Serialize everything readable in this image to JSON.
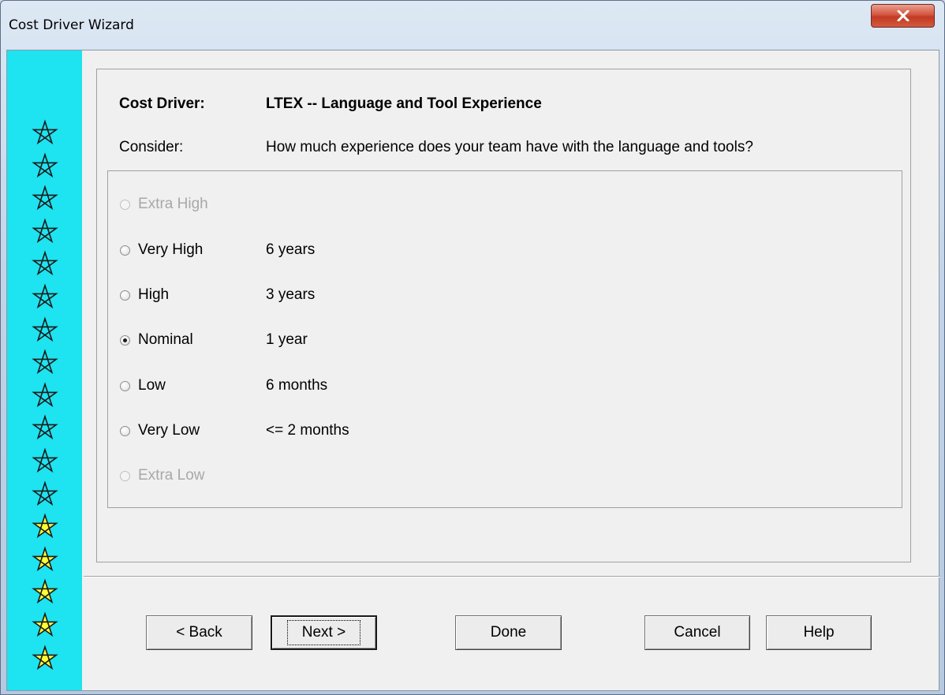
{
  "window": {
    "title": "Cost Driver Wizard",
    "close_icon": "close-icon",
    "accent_close": "#c8432c"
  },
  "sidebar": {
    "strip_color": "#1ee3f0",
    "stars": [
      {
        "icon": "star-outline-icon",
        "filled": false
      },
      {
        "icon": "star-outline-icon",
        "filled": false
      },
      {
        "icon": "star-outline-icon",
        "filled": false
      },
      {
        "icon": "star-outline-icon",
        "filled": false
      },
      {
        "icon": "star-outline-icon",
        "filled": false
      },
      {
        "icon": "star-outline-icon",
        "filled": false
      },
      {
        "icon": "star-outline-icon",
        "filled": false
      },
      {
        "icon": "star-outline-icon",
        "filled": false
      },
      {
        "icon": "star-outline-icon",
        "filled": false
      },
      {
        "icon": "star-outline-icon",
        "filled": false
      },
      {
        "icon": "star-outline-icon",
        "filled": false
      },
      {
        "icon": "star-outline-icon",
        "filled": false
      },
      {
        "icon": "star-filled-icon",
        "filled": true
      },
      {
        "icon": "star-filled-icon",
        "filled": true
      },
      {
        "icon": "star-filled-icon",
        "filled": true
      },
      {
        "icon": "star-filled-icon",
        "filled": true
      },
      {
        "icon": "star-filled-icon",
        "filled": true
      }
    ],
    "star_fill_color": "#ffff33"
  },
  "driver": {
    "label": "Cost Driver:",
    "value": "LTEX -- Language and Tool Experience",
    "consider_label": "Consider:",
    "consider_text": "How much experience does your team have with the language and tools?"
  },
  "options": [
    {
      "label": "Extra High",
      "desc": "",
      "enabled": false,
      "checked": false
    },
    {
      "label": "Very High",
      "desc": "6 years",
      "enabled": true,
      "checked": false
    },
    {
      "label": "High",
      "desc": "3 years",
      "enabled": true,
      "checked": false
    },
    {
      "label": "Nominal",
      "desc": "1 year",
      "enabled": true,
      "checked": true
    },
    {
      "label": "Low",
      "desc": "6 months",
      "enabled": true,
      "checked": false
    },
    {
      "label": "Very Low",
      "desc": "<= 2 months",
      "enabled": true,
      "checked": false
    },
    {
      "label": "Extra Low",
      "desc": "",
      "enabled": false,
      "checked": false
    }
  ],
  "buttons": {
    "back": "< Back",
    "next": "Next >",
    "done": "Done",
    "cancel": "Cancel",
    "help": "Help"
  }
}
